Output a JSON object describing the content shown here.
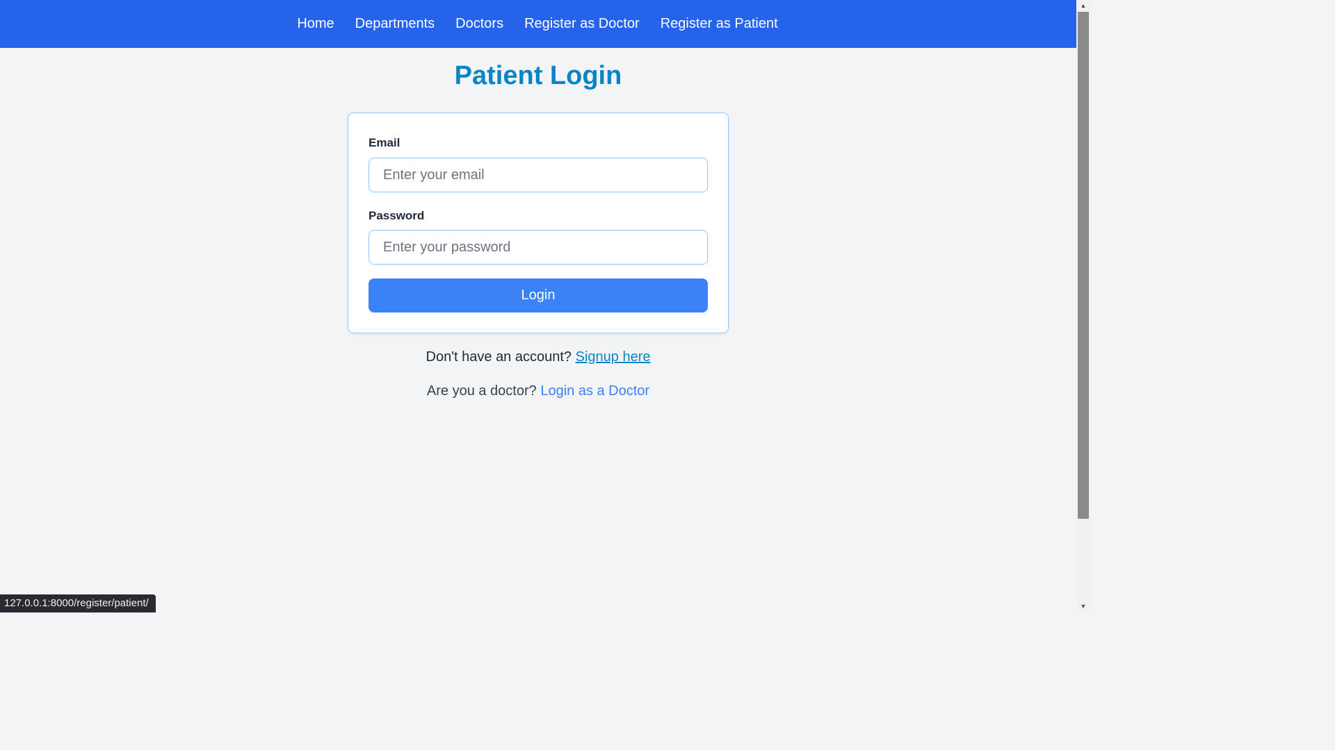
{
  "nav": {
    "items": [
      {
        "label": "Home"
      },
      {
        "label": "Departments"
      },
      {
        "label": "Doctors"
      },
      {
        "label": "Register as Doctor"
      },
      {
        "label": "Register as Patient"
      }
    ]
  },
  "page": {
    "title": "Patient Login"
  },
  "form": {
    "email_label": "Email",
    "email_placeholder": "Enter your email",
    "email_value": "",
    "password_label": "Password",
    "password_placeholder": "Enter your password",
    "password_value": "",
    "submit_label": "Login"
  },
  "footer": {
    "signup_prompt": "Don't have an account?",
    "signup_link": "Signup here",
    "doctor_prompt": "Are you a doctor?",
    "doctor_link": "Login as a Doctor"
  },
  "status_bar": {
    "url": "127.0.0.1:8000/register/patient/"
  },
  "colors": {
    "navbar": "#2563eb",
    "title": "#0b84c6",
    "button": "#3b82f6",
    "background": "#f3f4f6"
  },
  "icons": {
    "scroll_up": "scroll-up-arrow-icon",
    "scroll_down": "scroll-down-arrow-icon"
  }
}
